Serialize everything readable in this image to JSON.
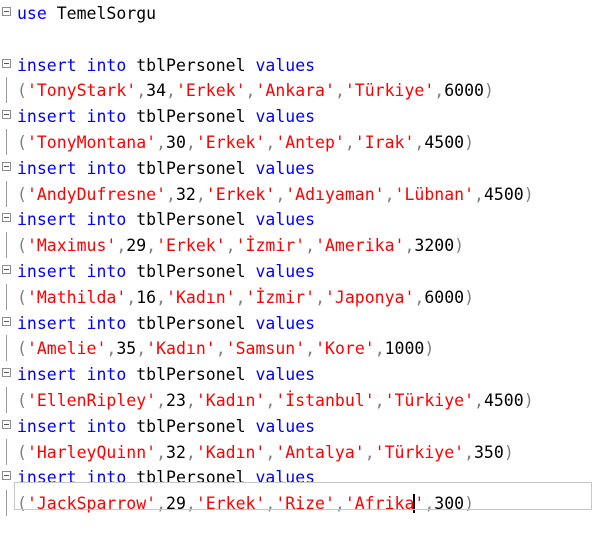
{
  "editor": {
    "use_keyword": "use",
    "database": "TemelSorgu",
    "insert_kw": "insert",
    "into_kw": "into",
    "table": "tblPersonel",
    "values_kw": "values",
    "rows": [
      {
        "name": "'TonyStark'",
        "age": "34",
        "gender": "'Erkek'",
        "city": "'Ankara'",
        "country": "'Türkiye'",
        "salary": "6000"
      },
      {
        "name": "'TonyMontana'",
        "age": "30",
        "gender": "'Erkek'",
        "city": "'Antep'",
        "country": "'Irak'",
        "salary": "4500"
      },
      {
        "name": "'AndyDufresne'",
        "age": "32",
        "gender": "'Erkek'",
        "city": "'Adıyaman'",
        "country": "'Lübnan'",
        "salary": "4500"
      },
      {
        "name": "'Maximus'",
        "age": "29",
        "gender": "'Erkek'",
        "city": "'İzmir'",
        "country": "'Amerika'",
        "salary": "3200"
      },
      {
        "name": "'Mathilda'",
        "age": "16",
        "gender": "'Kadın'",
        "city": "'İzmir'",
        "country": "'Japonya'",
        "salary": "6000"
      },
      {
        "name": "'Amelie'",
        "age": "35",
        "gender": "'Kadın'",
        "city": "'Samsun'",
        "country": "'Kore'",
        "salary": "1000"
      },
      {
        "name": "'EllenRipley'",
        "age": "23",
        "gender": "'Kadın'",
        "city": "'İstanbul'",
        "country": "'Türkiye'",
        "salary": "4500"
      },
      {
        "name": "'HarleyQuinn'",
        "age": "32",
        "gender": "'Kadın'",
        "city": "'Antalya'",
        "country": "'Türkiye'",
        "salary": "350"
      },
      {
        "name": "'JackSparrow'",
        "age": "29",
        "gender": "'Erkek'",
        "city": "'Rize'",
        "country": "'Afrika",
        "country_tail": "'",
        "salary": "300"
      }
    ],
    "colors": {
      "keyword": "#0000ff",
      "string": "#ff0000",
      "text": "#000000",
      "punct": "#808080"
    }
  }
}
